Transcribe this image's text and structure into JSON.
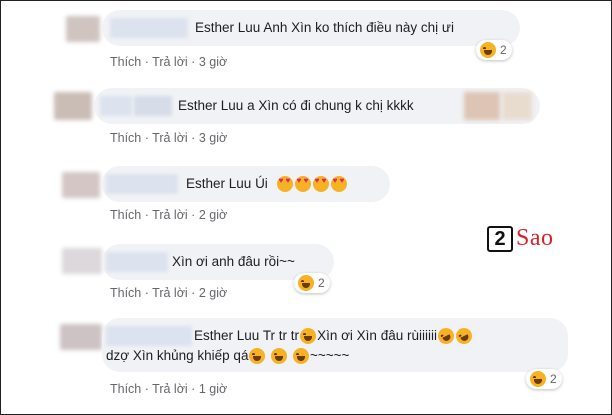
{
  "comments": [
    {
      "name": "Esther Luu",
      "text": "Anh Xìn ko thích điều này chị ưi",
      "action_like": "Thích",
      "action_reply": "Trả lời",
      "time": "3 giờ",
      "reaction_count": "2"
    },
    {
      "name": "Esther Luu",
      "text": "a Xìn có đi chung k chị kkkk",
      "action_like": "Thích",
      "action_reply": "Trả lời",
      "time": "3 giờ",
      "reaction_count": ""
    },
    {
      "name": "Esther Luu",
      "text": "Úi",
      "action_like": "Thích",
      "action_reply": "Trả lời",
      "time": "2 giờ",
      "reaction_count": ""
    },
    {
      "name": "",
      "text": "Xìn ơi anh đâu rồi~~",
      "action_like": "Thích",
      "action_reply": "Trả lời",
      "time": "2 giờ",
      "reaction_count": "2"
    },
    {
      "name": "Esther Luu",
      "text": "Tr tr tr",
      "text2": "Xìn ơi Xìn đâu rùiiiiii",
      "line2": "dzợ Xìn khủng khiếp qá",
      "line2_tail": "~~~~~",
      "action_like": "Thích",
      "action_reply": "Trả lời",
      "time": "1 giờ",
      "reaction_count": "2"
    }
  ],
  "separator": "·",
  "watermark": {
    "number": "2",
    "word": "Sao"
  },
  "colors": {
    "bubble": "#f0f2f5",
    "meta": "#65676b",
    "watermark_red": "#d9232a"
  }
}
